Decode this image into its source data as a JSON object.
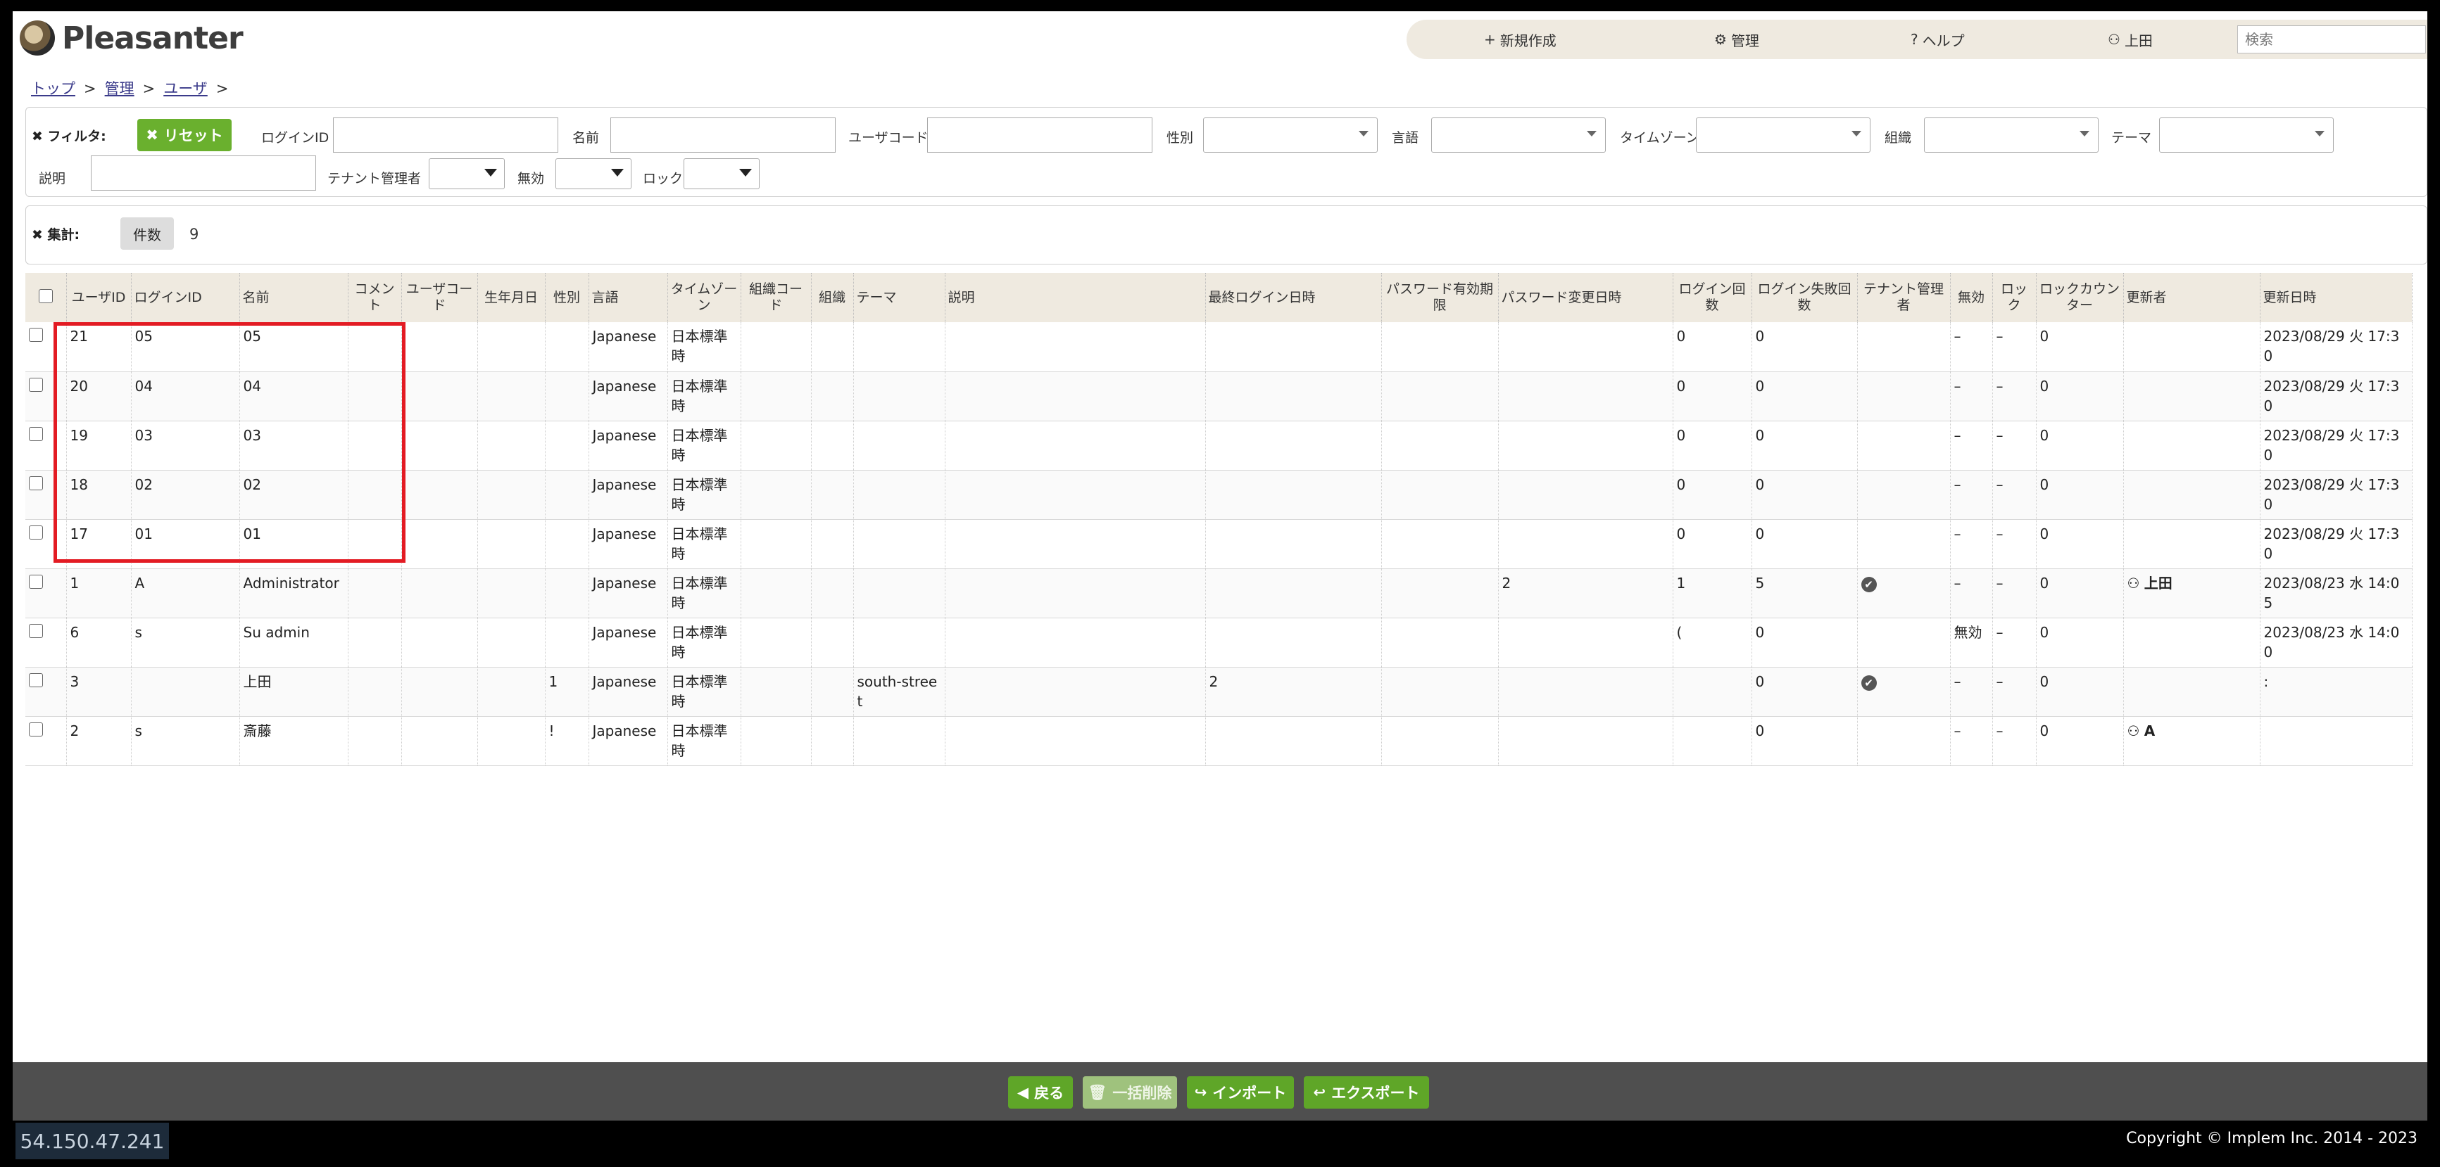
{
  "app": {
    "name": "Pleasanter"
  },
  "nav": {
    "new_label": "新規作成",
    "manage_label": "管理",
    "help_label": "ヘルプ",
    "user_label": "上田",
    "search_placeholder": "検索"
  },
  "breadcrumb": [
    "トップ",
    "管理",
    "ユーザ"
  ],
  "filter": {
    "title": "フィルタ:",
    "reset_label": "リセット",
    "labels": {
      "login_id": "ログインID",
      "name": "名前",
      "user_code": "ユーザコード",
      "gender": "性別",
      "language": "言語",
      "timezone": "タイムゾーン",
      "dept": "組織",
      "theme": "テーマ",
      "body": "説明",
      "tenant_manager": "テナント管理者",
      "disabled": "無効",
      "lockout": "ロック"
    }
  },
  "aggregate": {
    "title": "集計:",
    "count_label": "件数",
    "count_value": "9"
  },
  "table": {
    "headers": {
      "user_id": "ユーザID",
      "login_id": "ログインID",
      "name": "名前",
      "comment": "コメント",
      "user_code": "ユーザコード",
      "birthday": "生年月日",
      "gender": "性別",
      "language": "言語",
      "timezone": "タイムゾーン",
      "dept_code": "組織コード",
      "dept": "組織",
      "theme": "テーマ",
      "body": "説明",
      "last_login": "最終ログイン日時",
      "password_expiration": "パスワード有効期限",
      "password_change": "パスワード変更日時",
      "login_count": "ログイン回数",
      "login_fail_count": "ログイン失敗回数",
      "tenant_manager": "テナント管理者",
      "disabled": "無効",
      "lockout": "ロック",
      "lockout_counter": "ロックカウンター",
      "updator": "更新者",
      "updated": "更新日時"
    },
    "rows": [
      {
        "user_id": "21",
        "login_id": "05",
        "name": "05",
        "gender": "",
        "language": "Japanese",
        "timezone": "日本標準時",
        "theme": "",
        "last_login": "",
        "password_change": "",
        "login_count": "0",
        "login_fail_count": "0",
        "tenant_manager": false,
        "disabled": "–",
        "lockout": "–",
        "lockout_counter": "0",
        "updator": "",
        "updated": "2023/08/29 火 17:30"
      },
      {
        "user_id": "20",
        "login_id": "04",
        "name": "04",
        "gender": "",
        "language": "Japanese",
        "timezone": "日本標準時",
        "theme": "",
        "last_login": "",
        "password_change": "",
        "login_count": "0",
        "login_fail_count": "0",
        "tenant_manager": false,
        "disabled": "–",
        "lockout": "–",
        "lockout_counter": "0",
        "updator": "",
        "updated": "2023/08/29 火 17:30"
      },
      {
        "user_id": "19",
        "login_id": "03",
        "name": "03",
        "gender": "",
        "language": "Japanese",
        "timezone": "日本標準時",
        "theme": "",
        "last_login": "",
        "password_change": "",
        "login_count": "0",
        "login_fail_count": "0",
        "tenant_manager": false,
        "disabled": "–",
        "lockout": "–",
        "lockout_counter": "0",
        "updator": "",
        "updated": "2023/08/29 火 17:30"
      },
      {
        "user_id": "18",
        "login_id": "02",
        "name": "02",
        "gender": "",
        "language": "Japanese",
        "timezone": "日本標準時",
        "theme": "",
        "last_login": "",
        "password_change": "",
        "login_count": "0",
        "login_fail_count": "0",
        "tenant_manager": false,
        "disabled": "–",
        "lockout": "–",
        "lockout_counter": "0",
        "updator": "",
        "updated": "2023/08/29 火 17:30"
      },
      {
        "user_id": "17",
        "login_id": "01",
        "name": "01",
        "gender": "",
        "language": "Japanese",
        "timezone": "日本標準時",
        "theme": "",
        "last_login": "",
        "password_change": "",
        "login_count": "0",
        "login_fail_count": "0",
        "tenant_manager": false,
        "disabled": "–",
        "lockout": "–",
        "lockout_counter": "0",
        "updator": "",
        "updated": "2023/08/29 火 17:30"
      },
      {
        "user_id": "1",
        "login_id": "A",
        "name": "Administrator",
        "gender": "",
        "language": "Japanese",
        "timezone": "日本標準時",
        "theme": "",
        "last_login": "",
        "password_change": "2",
        "login_count": "1",
        "login_fail_count": "5",
        "tenant_manager": true,
        "disabled": "–",
        "lockout": "–",
        "lockout_counter": "0",
        "updator": "上田",
        "updated": "2023/08/23 水 14:05"
      },
      {
        "user_id": "6",
        "login_id": "s",
        "name": "Su admin",
        "gender": "",
        "language": "Japanese",
        "timezone": "日本標準時",
        "theme": "",
        "last_login": "",
        "password_change": "",
        "login_count": "(",
        "login_fail_count": "0",
        "tenant_manager": false,
        "disabled": "無効",
        "lockout": "–",
        "lockout_counter": "0",
        "updator": "",
        "updated": "2023/08/23 水 14:00"
      },
      {
        "user_id": "3",
        "login_id": "",
        "name": "上田",
        "gender": "1",
        "language": "Japanese",
        "timezone": "日本標準時",
        "theme": "south-street",
        "last_login": "2",
        "password_change": "",
        "login_count": "",
        "login_fail_count": "0",
        "tenant_manager": true,
        "disabled": "–",
        "lockout": "–",
        "lockout_counter": "0",
        "updator": "",
        "updated": ":"
      },
      {
        "user_id": "2",
        "login_id": "s",
        "name": "斎藤",
        "gender": "!",
        "language": "Japanese",
        "timezone": "日本標準時",
        "theme": "",
        "last_login": "",
        "password_change": "",
        "login_count": "",
        "login_fail_count": "0",
        "tenant_manager": false,
        "disabled": "–",
        "lockout": "–",
        "lockout_counter": "0",
        "updator": "A",
        "updated": ""
      }
    ]
  },
  "footer": {
    "back_label": "戻る",
    "bulk_delete_label": "一括削除",
    "import_label": "インポート",
    "export_label": "エクスポート",
    "ip": "54.150.47.241",
    "copyright": "Copyright © Implem Inc. 2014 - 2023"
  },
  "colors": {
    "accent_green": "#6ab02e",
    "header_bg": "#efeae0",
    "highlight": "#e31b23"
  }
}
